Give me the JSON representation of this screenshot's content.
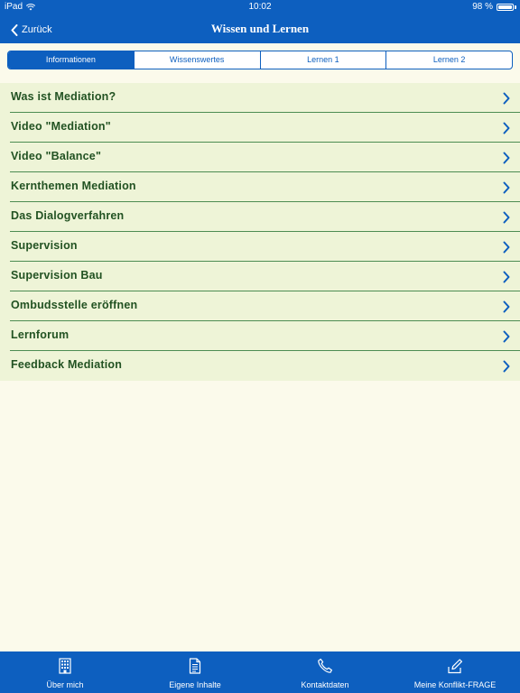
{
  "status_bar": {
    "device": "iPad",
    "time": "10:02",
    "battery": "98 %",
    "battery_level": 0.98
  },
  "navbar": {
    "back_label": "Zurück",
    "title": "Wissen und Lernen"
  },
  "segments": [
    {
      "label": "Informationen",
      "active": true
    },
    {
      "label": "Wissenswertes",
      "active": false
    },
    {
      "label": "Lernen 1",
      "active": false
    },
    {
      "label": "Lernen 2",
      "active": false
    }
  ],
  "list": {
    "items": [
      {
        "label": "Was ist Mediation?"
      },
      {
        "label": "Video \"Mediation\""
      },
      {
        "label": "Video \"Balance\""
      },
      {
        "label": "Kernthemen Mediation"
      },
      {
        "label": "Das Dialogverfahren"
      },
      {
        "label": "Supervision"
      },
      {
        "label": "Supervision Bau"
      },
      {
        "label": "Ombudsstelle eröffnen"
      },
      {
        "label": "Lernforum"
      },
      {
        "label": "Feedback Mediation"
      }
    ]
  },
  "tabbar": {
    "items": [
      {
        "label": "Über mich",
        "icon": "building-icon"
      },
      {
        "label": "Eigene Inhalte",
        "icon": "document-icon"
      },
      {
        "label": "Kontaktdaten",
        "icon": "phone-icon"
      },
      {
        "label": "Meine Konflikt-FRAGE",
        "icon": "edit-icon"
      }
    ]
  },
  "colors": {
    "primary_blue": "#0d5fbf",
    "list_background": "#eef4d7",
    "list_text_green": "#225222",
    "divider_green": "#4d8c52",
    "page_background": "#fbfaeb"
  }
}
